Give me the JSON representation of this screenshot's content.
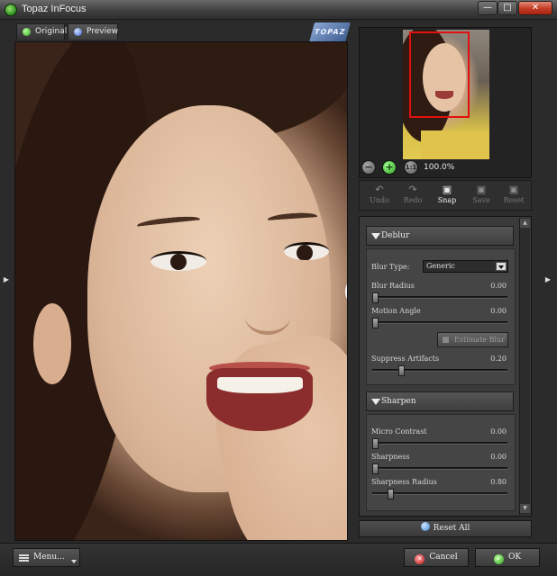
{
  "window": {
    "title": "Topaz InFocus"
  },
  "tabs": [
    {
      "label": "Original"
    },
    {
      "label": "Preview"
    }
  ],
  "navigator": {
    "zoom_level": "100.0%"
  },
  "toolbar": {
    "undo": "Undo",
    "redo": "Redo",
    "snap": "Snap",
    "save": "Save",
    "reset": "Reset"
  },
  "deblur": {
    "header": "Deblur",
    "blur_type_label": "Blur Type:",
    "blur_type_value": "Generic",
    "blur_radius_label": "Blur Radius",
    "blur_radius_value": "0.00",
    "blur_radius_level": 0.0,
    "motion_angle_label": "Motion Angle",
    "motion_angle_value": "0.00",
    "motion_angle_level": 0.0,
    "estimate_blur_label": "Estimate Blur",
    "suppress_artifacts_label": "Suppress Artifacts",
    "suppress_artifacts_value": "0.20",
    "suppress_artifacts_level": 0.2
  },
  "sharpen": {
    "header": "Sharpen",
    "micro_contrast_label": "Micro Contrast",
    "micro_contrast_value": "0.00",
    "micro_contrast_level": 0.0,
    "sharpness_label": "Sharpness",
    "sharpness_value": "0.00",
    "sharpness_level": 0.0,
    "sharpness_radius_label": "Sharpness Radius",
    "sharpness_radius_value": "0.80",
    "sharpness_radius_level": 0.12
  },
  "buttons": {
    "reset_all": "Reset All",
    "menu": "Menu...",
    "cancel": "Cancel",
    "ok": "OK"
  },
  "colors": {
    "close_red": "#c23a23",
    "ok_green": "#2a9a1c",
    "navigator_rect": "#e01010"
  }
}
